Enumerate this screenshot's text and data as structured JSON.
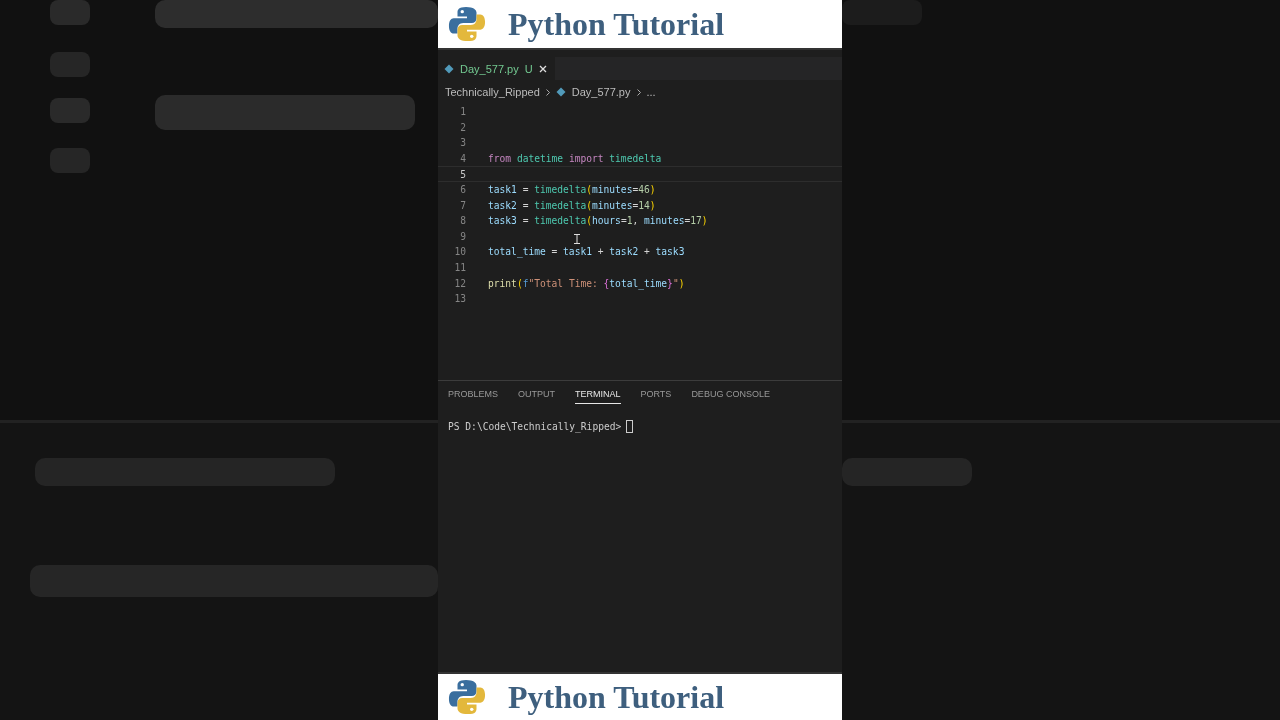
{
  "top_banner": {
    "title": "Python Tutorial"
  },
  "editor": {
    "tabs": [
      {
        "label": "Day_577.py",
        "badge": "U",
        "selected": true
      }
    ],
    "breadcrumb": [
      "Technically_Ripped",
      "Day_577.py",
      "..."
    ],
    "lines": [
      {
        "number": "1",
        "current": false
      },
      {
        "number": "2",
        "current": false
      },
      {
        "number": "3",
        "current": false
      },
      {
        "number": "4",
        "current": false,
        "tokens": [
          {
            "text": "from ",
            "kind": "keyword"
          },
          {
            "text": "datetime ",
            "kind": "type"
          },
          {
            "text": "import ",
            "kind": "keyword"
          },
          {
            "text": "timedelta",
            "kind": "type"
          }
        ]
      },
      {
        "number": "5",
        "current": true
      },
      {
        "number": "6",
        "current": false,
        "tokens": [
          {
            "text": "task1",
            "kind": "variable"
          },
          {
            "text": " = ",
            "kind": "plain"
          },
          {
            "text": "timedelta",
            "kind": "type"
          },
          {
            "text": "(",
            "kind": "paren"
          },
          {
            "text": "minutes",
            "kind": "variable"
          },
          {
            "text": "=",
            "kind": "plain"
          },
          {
            "text": "46",
            "kind": "number"
          },
          {
            "text": ")",
            "kind": "paren"
          }
        ]
      },
      {
        "number": "7",
        "current": false,
        "tokens": [
          {
            "text": "task2",
            "kind": "variable"
          },
          {
            "text": " = ",
            "kind": "plain"
          },
          {
            "text": "timedelta",
            "kind": "type"
          },
          {
            "text": "(",
            "kind": "paren"
          },
          {
            "text": "minutes",
            "kind": "variable"
          },
          {
            "text": "=",
            "kind": "plain"
          },
          {
            "text": "14",
            "kind": "number"
          },
          {
            "text": ")",
            "kind": "paren"
          }
        ]
      },
      {
        "number": "8",
        "current": false,
        "tokens": [
          {
            "text": "task3",
            "kind": "variable"
          },
          {
            "text": " = ",
            "kind": "plain"
          },
          {
            "text": "timedelta",
            "kind": "type"
          },
          {
            "text": "(",
            "kind": "paren"
          },
          {
            "text": "hours",
            "kind": "variable"
          },
          {
            "text": "=",
            "kind": "plain"
          },
          {
            "text": "1",
            "kind": "number"
          },
          {
            "text": ", ",
            "kind": "plain"
          },
          {
            "text": "minutes",
            "kind": "variable"
          },
          {
            "text": "=",
            "kind": "plain"
          },
          {
            "text": "17",
            "kind": "number"
          },
          {
            "text": ")",
            "kind": "paren"
          }
        ]
      },
      {
        "number": "9",
        "current": false
      },
      {
        "number": "10",
        "current": false,
        "tokens": [
          {
            "text": "total_time",
            "kind": "variable"
          },
          {
            "text": " = ",
            "kind": "plain"
          },
          {
            "text": "task1",
            "kind": "variable"
          },
          {
            "text": " + ",
            "kind": "plain"
          },
          {
            "text": "task2",
            "kind": "variable"
          },
          {
            "text": " + ",
            "kind": "plain"
          },
          {
            "text": "task3",
            "kind": "variable"
          }
        ]
      },
      {
        "number": "11",
        "current": false
      },
      {
        "number": "12",
        "current": false,
        "tokens": [
          {
            "text": "print",
            "kind": "function"
          },
          {
            "text": "(",
            "kind": "paren"
          },
          {
            "text": "f",
            "kind": "keyword2"
          },
          {
            "text": "\"Total Time: ",
            "kind": "string"
          },
          {
            "text": "{",
            "kind": "brace"
          },
          {
            "text": "total_time",
            "kind": "variable"
          },
          {
            "text": "}",
            "kind": "brace"
          },
          {
            "text": "\"",
            "kind": "string"
          },
          {
            "text": ")",
            "kind": "paren"
          }
        ]
      },
      {
        "number": "13",
        "current": false
      }
    ]
  },
  "panel": {
    "tabs": [
      {
        "label": "PROBLEMS",
        "selected": false
      },
      {
        "label": "OUTPUT",
        "selected": false
      },
      {
        "label": "TERMINAL",
        "selected": true
      },
      {
        "label": "PORTS",
        "selected": false
      },
      {
        "label": "DEBUG CONSOLE",
        "selected": false
      }
    ],
    "prompt": "PS D:\\Code\\Technically_Ripped>"
  },
  "bottom_banner": {
    "title": "Python Tutorial"
  }
}
